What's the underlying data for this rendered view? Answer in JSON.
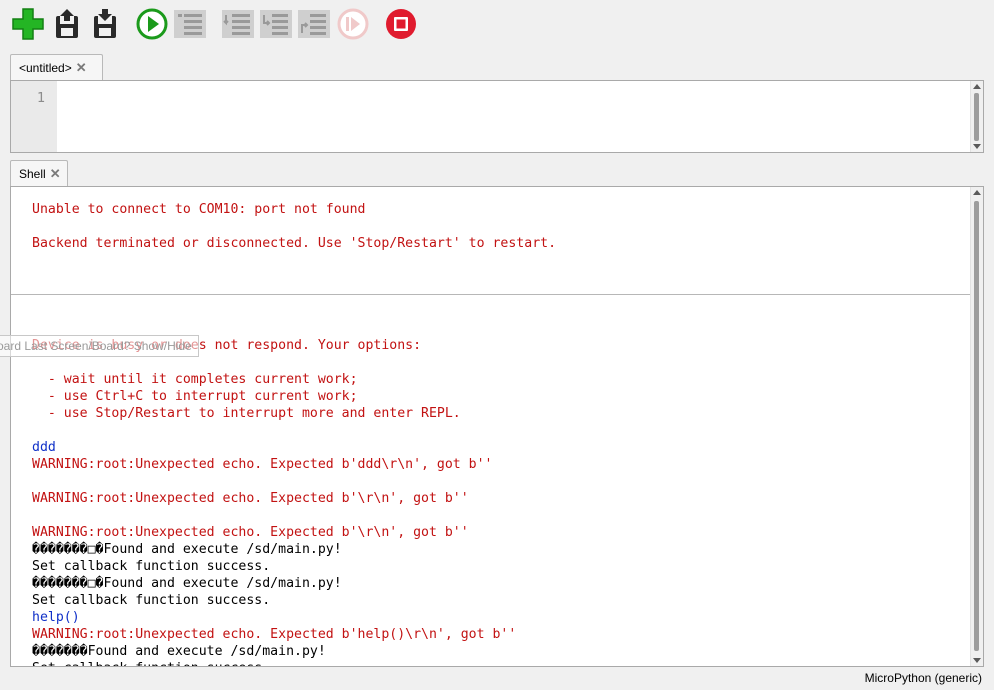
{
  "toolbar": {
    "buttons": [
      {
        "name": "new-file",
        "icon": "plus-icon"
      },
      {
        "name": "load",
        "icon": "load-icon"
      },
      {
        "name": "save",
        "icon": "save-icon"
      },
      {
        "name": "run",
        "icon": "play-icon"
      },
      {
        "name": "debug",
        "icon": "debug-icon"
      },
      {
        "name": "step-over",
        "icon": "step-over-icon"
      },
      {
        "name": "step-into",
        "icon": "step-into-icon"
      },
      {
        "name": "step-out",
        "icon": "step-out-icon"
      },
      {
        "name": "resume",
        "icon": "resume-icon"
      },
      {
        "name": "stop",
        "icon": "stop-icon"
      }
    ],
    "colors": {
      "green": "#1fa51f",
      "red": "#e01b2e",
      "disabled": "#c9c9c9"
    }
  },
  "editor": {
    "tab_label": "<untitled>",
    "line_number": "1"
  },
  "shell": {
    "tab_label": "Shell",
    "lines": [
      {
        "text": "Unable to connect to COM10: port not found",
        "color": "red"
      },
      {
        "text": "",
        "color": "black"
      },
      {
        "text": "Backend terminated or disconnected. Use 'Stop/Restart' to restart.",
        "color": "red"
      },
      {
        "text": "",
        "color": "black"
      },
      {
        "text": "",
        "color": "black"
      },
      {
        "separator": true
      },
      {
        "text": "",
        "color": "black"
      },
      {
        "text": "",
        "color": "black"
      },
      {
        "text": "Device is busy or does not respond. Your options:",
        "color": "red"
      },
      {
        "text": "",
        "color": "black"
      },
      {
        "text": "  - wait until it completes current work;",
        "color": "red"
      },
      {
        "text": "  - use Ctrl+C to interrupt current work;",
        "color": "red"
      },
      {
        "text": "  - use Stop/Restart to interrupt more and enter REPL.",
        "color": "red"
      },
      {
        "text": "",
        "color": "black"
      },
      {
        "text": "ddd",
        "color": "blue"
      },
      {
        "text": "WARNING:root:Unexpected echo. Expected b'ddd\\r\\n', got b''",
        "color": "red"
      },
      {
        "text": "",
        "color": "black"
      },
      {
        "text": "WARNING:root:Unexpected echo. Expected b'\\r\\n', got b''",
        "color": "red"
      },
      {
        "text": "",
        "color": "black"
      },
      {
        "text": "WARNING:root:Unexpected echo. Expected b'\\r\\n', got b''",
        "color": "red"
      },
      {
        "text": "�������□�Found and execute /sd/main.py!",
        "color": "black"
      },
      {
        "text": "Set callback function success.",
        "color": "black"
      },
      {
        "text": "�������□�Found and execute /sd/main.py!",
        "color": "black"
      },
      {
        "text": "Set callback function success.",
        "color": "black"
      },
      {
        "text": "help()",
        "color": "blue"
      },
      {
        "text": "WARNING:root:Unexpected echo. Expected b'help()\\r\\n', got b''",
        "color": "red"
      },
      {
        "text": "�������Found and execute /sd/main.py!",
        "color": "black"
      },
      {
        "text": "Set callback function success.",
        "color": "black"
      }
    ]
  },
  "tooltip": {
    "text": "oard Last Screen/Board? Show/Hide"
  },
  "status": {
    "interpreter": "MicroPython (generic)"
  }
}
